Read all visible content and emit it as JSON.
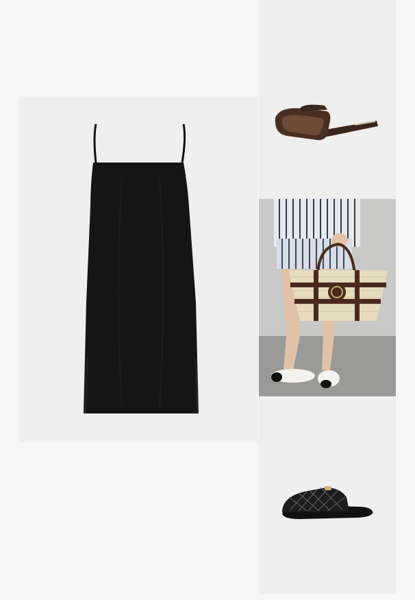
{
  "collage": {
    "items": [
      {
        "name": "dress",
        "description_visible_text": ""
      },
      {
        "name": "sunglasses",
        "description_visible_text": ""
      },
      {
        "name": "tote-bag-model-photo",
        "description_visible_text": ""
      },
      {
        "name": "mules",
        "description_visible_text": ""
      }
    ]
  },
  "colors": {
    "page_bg": "#f7f7f7",
    "tile_bg": "#efefef",
    "dress": "#141414",
    "sunglasses_frame": "#4a2e22",
    "sunglasses_lens": "#6b4b36",
    "bag_straw": "#e7dcc0",
    "bag_leather": "#4a2a1e",
    "stripe_dark": "#2f3a4a",
    "mule": "#1a1a1a"
  }
}
